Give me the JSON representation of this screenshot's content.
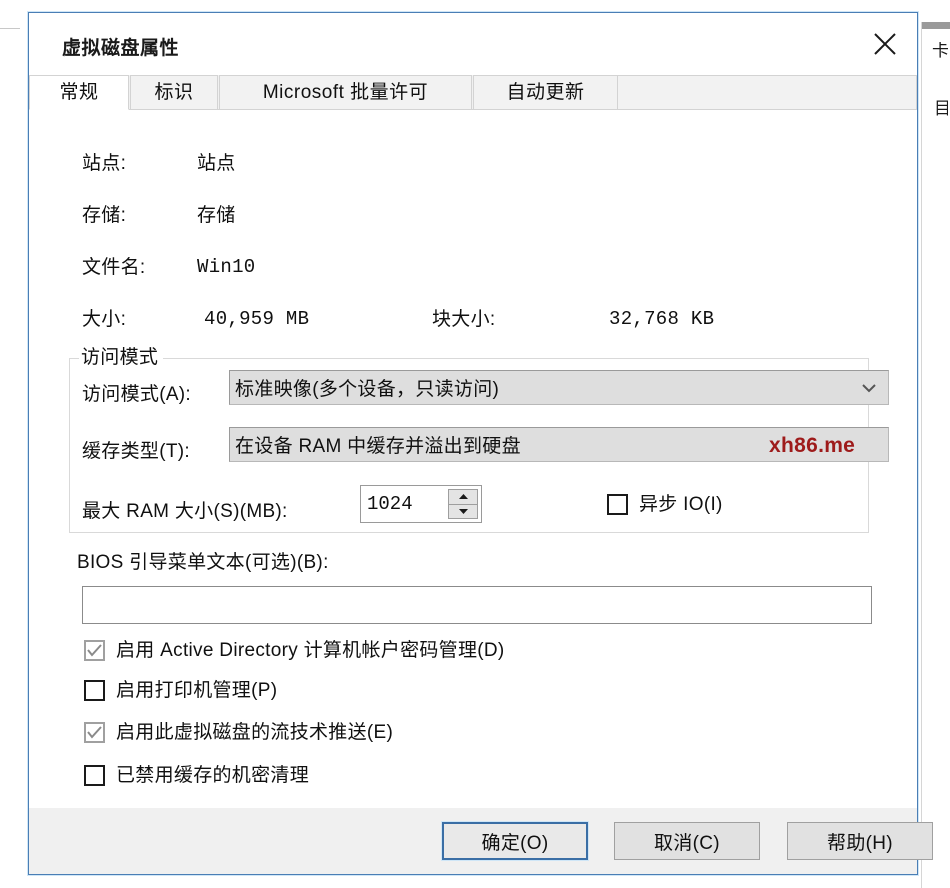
{
  "dialog": {
    "title": "虚拟磁盘属性",
    "close_icon": "close-icon"
  },
  "tabs": [
    {
      "label": "常规",
      "active": true
    },
    {
      "label": "标识",
      "active": false
    },
    {
      "label": "Microsoft 批量许可",
      "active": false
    },
    {
      "label": "自动更新",
      "active": false
    }
  ],
  "general": {
    "site_label": "站点:",
    "site_value": "站点",
    "store_label": "存储:",
    "store_value": "存储",
    "filename_label": "文件名:",
    "filename_value": "Win10",
    "size_label": "大小:",
    "size_value": "40,959 MB",
    "blocksize_label": "块大小:",
    "blocksize_value": "32,768 KB"
  },
  "access_group": {
    "legend": "访问模式",
    "access_mode_label": "访问模式(A):",
    "access_mode_value": "标准映像(多个设备，只读访问)",
    "cache_type_label": "缓存类型(T):",
    "cache_type_value": "在设备 RAM 中缓存并溢出到硬盘",
    "max_ram_label": "最大 RAM 大小(S)(MB):",
    "max_ram_value": "1024",
    "async_io_label": "异步 IO(I)",
    "async_io_checked": false
  },
  "watermark": {
    "text": "xh86.me",
    "color": "#9e1b1b"
  },
  "bios": {
    "label": "BIOS 引导菜单文本(可选)(B):",
    "value": "",
    "placeholder": ""
  },
  "checkboxes": [
    {
      "label": "启用 Active Directory 计算机帐户密码管理(D)",
      "checked": true
    },
    {
      "label": "启用打印机管理(P)",
      "checked": false
    },
    {
      "label": "启用此虚拟磁盘的流技术推送(E)",
      "checked": true
    },
    {
      "label": "已禁用缓存的机密清理",
      "checked": false
    }
  ],
  "footer": {
    "ok_label": "确定(O)",
    "cancel_label": "取消(C)",
    "help_label": "帮助(H)"
  },
  "background_window": {
    "text_top": "卡",
    "text_bottom": "目"
  }
}
